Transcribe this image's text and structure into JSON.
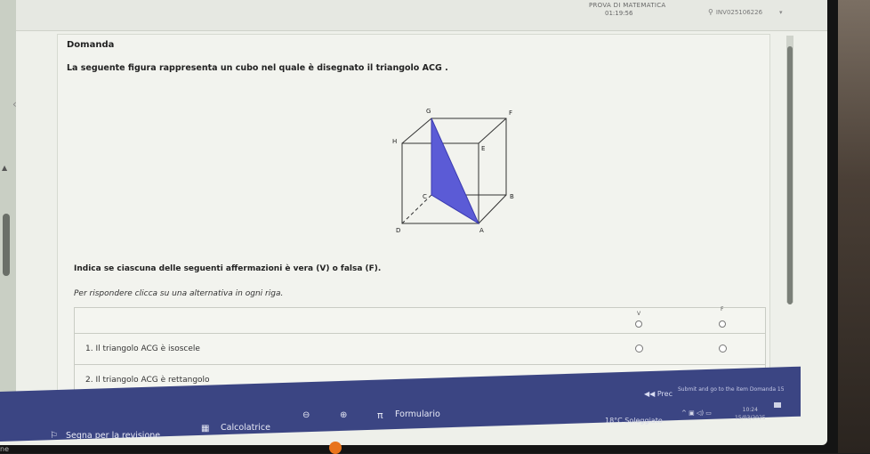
{
  "header": {
    "exam_title": "PROVA DI MATEMATICA",
    "timer": "01:19:56",
    "user_id": "INV025106226"
  },
  "question": {
    "number_label": "Domanda",
    "text": "La seguente figura rappresenta un cubo nel quale è disegnato il triangolo ACG .",
    "figure_labels": {
      "G": "G",
      "F": "F",
      "H": "H",
      "E": "E",
      "C": "C",
      "B": "B",
      "D": "D",
      "A": "A"
    },
    "instruction": "Indica se ciascuna delle seguenti affermazioni è vera (V) o falsa (F).",
    "hint": "Per rispondere clicca su una alternativa in ogni riga."
  },
  "table": {
    "col_v": "V",
    "col_f": "F",
    "rows": [
      {
        "label": "1. Il triangolo ACG è isoscele"
      },
      {
        "label": "2. Il triangolo ACG è rettangolo"
      }
    ]
  },
  "navigation": {
    "prev_label": "Prec",
    "next_hint": "Submit and go to the item Domanda 15"
  },
  "footer": {
    "review_label": "Segna per la revisione",
    "calculator_label": "Calcolatrice",
    "formulary_label": "Formulario"
  },
  "taskbar": {
    "weather": "18°C  Soleggiato",
    "time": "10:24",
    "date": "15/03/2025"
  },
  "edge_text": "ne",
  "colors": {
    "triangle_fill": "#5b5bd6",
    "bottom_bar": "#3b4583",
    "screen_bg": "#eef0ea"
  }
}
